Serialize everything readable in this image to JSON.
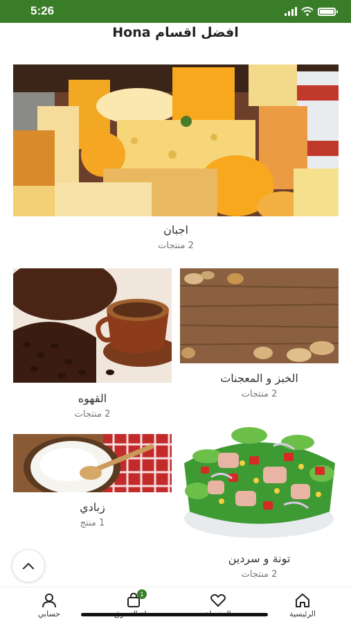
{
  "status_bar": {
    "time": "5:26"
  },
  "page_title": "افضل اقسام Hona",
  "categories": [
    {
      "name": "اجبان",
      "count": "2 منتجات"
    },
    {
      "name": "الخبز و المعجنات",
      "count": "2 منتجات"
    },
    {
      "name": "القهوه",
      "count": "2 منتجات"
    },
    {
      "name": "تونة و سردين",
      "count": "2 منتجات"
    },
    {
      "name": "زبادي",
      "count": "1 منتج"
    }
  ],
  "tab_bar": {
    "home": "الرئيسية",
    "favorites": "المفضلة",
    "cart": "سلة التسوق",
    "cart_badge": "1",
    "account": "حسابي"
  },
  "colors": {
    "brand": "#3a7d28"
  }
}
